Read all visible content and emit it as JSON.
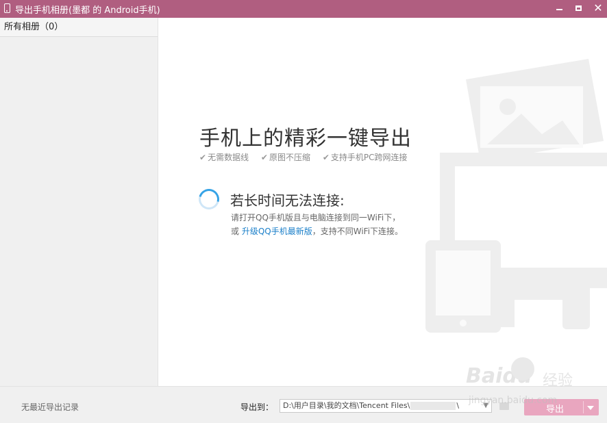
{
  "window": {
    "title": "导出手机相册(墨都 的 Android手机)",
    "minimize_label": "",
    "maximize_label": "",
    "close_label": "✕"
  },
  "sidebar": {
    "album_label": "所有相册（0）"
  },
  "main": {
    "headline": "手机上的精彩一键导出",
    "features": [
      "无需数据线",
      "原图不压缩",
      "支持手机PC跨网连接"
    ],
    "connection": {
      "title": "若长时间无法连接:",
      "line1": "请打开QQ手机版且与电脑连接到同一WiFi下，",
      "line2_prefix": "或",
      "upgrade_link": "升级QQ手机最新版",
      "line2_suffix": "，支持不同WiFi下连接。"
    }
  },
  "footer": {
    "no_records": "无最近导出记录",
    "export_to_label": "导出到：",
    "path_start": "D:\\用户目录\\我的文档\\Tencent Files\\",
    "path_end": "\\",
    "export_button": "导出"
  },
  "watermark": {
    "brand": "Baidu",
    "brand_cn": "经验",
    "url": "jingyan.baidu.com"
  },
  "colors": {
    "titlebar": "#b05e80",
    "accent_link": "#1a7fc9",
    "export_button": "#e9a6bf"
  }
}
